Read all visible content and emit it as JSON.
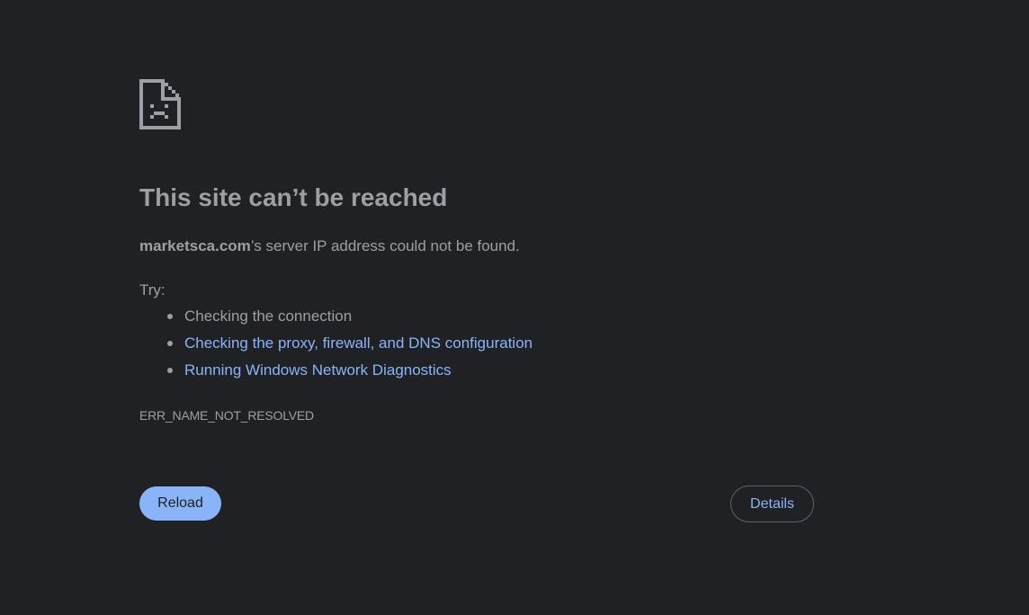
{
  "error_page": {
    "icon": "sad-file-icon",
    "title": "This site can’t be reached",
    "summary": {
      "domain": "marketsca.com",
      "message": "’s server IP address could not be found."
    },
    "try_label": "Try:",
    "suggestions": [
      {
        "label": "Checking the connection",
        "is_link": false
      },
      {
        "label": "Checking the proxy, firewall, and DNS configuration",
        "is_link": true
      },
      {
        "label": "Running Windows Network Diagnostics",
        "is_link": true
      }
    ],
    "error_code": "ERR_NAME_NOT_RESOLVED",
    "reload_label": "Reload",
    "details_label": "Details"
  },
  "colors": {
    "background": "#202124",
    "text": "#9aa0a6",
    "link": "#8ab4f8",
    "primary_button": "#8ab4f8",
    "border": "#5f6368"
  }
}
